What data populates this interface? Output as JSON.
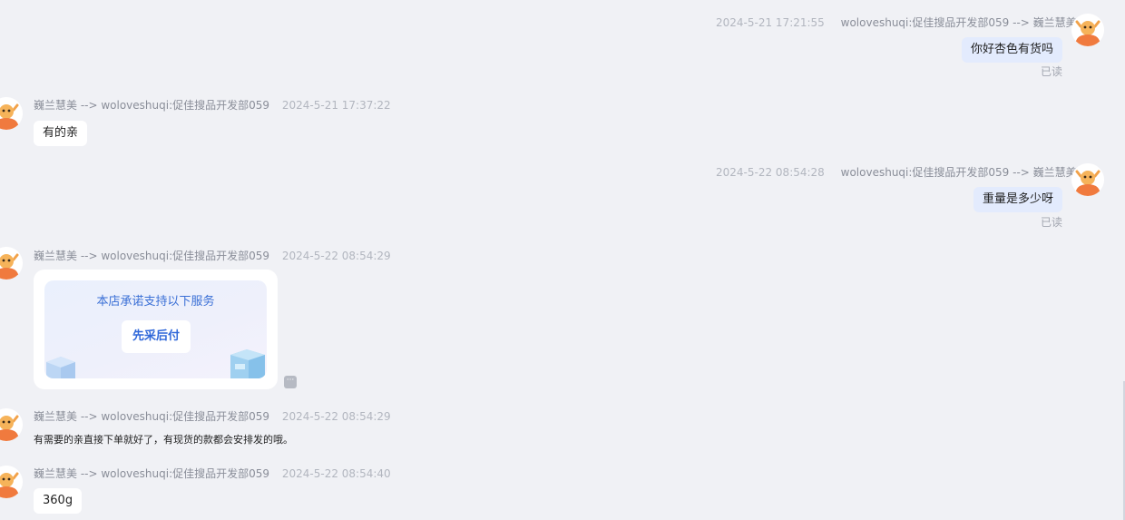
{
  "messages": [
    {
      "id": "m1",
      "meta": {
        "time": "2024-5-21 17:21:55",
        "route": "woloveshuqi:促佳搜品开发部059 --> 巍兰慧美"
      },
      "text": "你好杏色有货吗",
      "status": "已读"
    },
    {
      "id": "m2",
      "meta": {
        "route": "巍兰慧美 --> woloveshuqi:促佳搜品开发部059",
        "time": "2024-5-21 17:37:22"
      },
      "text": "有的亲"
    },
    {
      "id": "m3",
      "meta": {
        "time": "2024-5-22 08:54:28",
        "route": "woloveshuqi:促佳搜品开发部059 --> 巍兰慧美"
      },
      "text": "重量是多少呀",
      "status": "已读"
    },
    {
      "id": "m4",
      "meta": {
        "route": "巍兰慧美 --> woloveshuqi:促佳搜品开发部059",
        "time": "2024-5-22 08:54:29"
      },
      "card": {
        "title": "本店承诺支持以下服务",
        "chip": "先采后付",
        "more_icon": "ellipsis-icon"
      }
    },
    {
      "id": "m5",
      "meta": {
        "route": "巍兰慧美 --> woloveshuqi:促佳搜品开发部059",
        "time": "2024-5-22 08:54:29"
      },
      "text": "有需要的亲直接下单就好了，有现货的款都会安排发的哦。"
    },
    {
      "id": "m6",
      "meta": {
        "route": "巍兰慧美 --> woloveshuqi:促佳搜品开发部059",
        "time": "2024-5-22 08:54:40"
      },
      "text": "360g"
    }
  ],
  "colors": {
    "background": "#f0f1f5",
    "outgoing_bubble": "#e3ebfd",
    "incoming_bubble": "#ffffff",
    "card_accent": "#2f67d9",
    "avatar_accent": "#f07a3e"
  },
  "icons": {
    "avatar": "cartoon-mascot-avatar-icon"
  }
}
